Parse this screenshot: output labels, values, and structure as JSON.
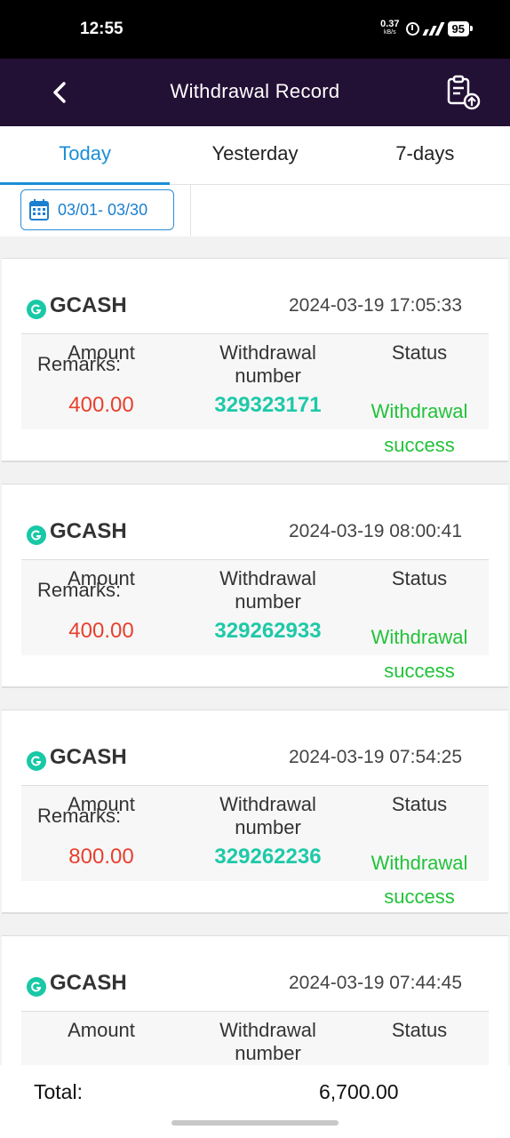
{
  "status_bar": {
    "time": "12:55",
    "net_speed": "0.37",
    "net_unit": "kB/s",
    "battery": "95"
  },
  "header": {
    "title": "Withdrawal Record",
    "back_icon": "chevron-left-icon",
    "action_icon": "clipboard-upload-icon"
  },
  "tabs": [
    {
      "label": "Today",
      "active": true
    },
    {
      "label": "Yesterday",
      "active": false
    },
    {
      "label": "7-days",
      "active": false
    }
  ],
  "date_filter": {
    "label": "03/01- 03/30",
    "icon": "calendar-icon"
  },
  "columns": {
    "amount": "Amount",
    "withdrawal_number": "Withdrawal number",
    "status": "Status",
    "remarks": "Remarks"
  },
  "records": [
    {
      "method": "GCASH",
      "datetime": "2024-03-19 17:05:33",
      "amount": "400.00",
      "number": "329323171",
      "status": "Withdrawal success"
    },
    {
      "method": "GCASH",
      "datetime": "2024-03-19 08:00:41",
      "amount": "400.00",
      "number": "329262933",
      "status": "Withdrawal success"
    },
    {
      "method": "GCASH",
      "datetime": "2024-03-19 07:54:25",
      "amount": "800.00",
      "number": "329262236",
      "status": "Withdrawal success"
    },
    {
      "method": "GCASH",
      "datetime": "2024-03-19 07:44:45",
      "amount": "",
      "number": "",
      "status": ""
    }
  ],
  "footer": {
    "total_label": "Total:",
    "total_value": "6,700.00"
  },
  "colors": {
    "header_bg": "#231035",
    "accent": "#1b8fd6",
    "amount": "#e8402e",
    "number": "#1ec9a8",
    "success": "#22c23a"
  }
}
